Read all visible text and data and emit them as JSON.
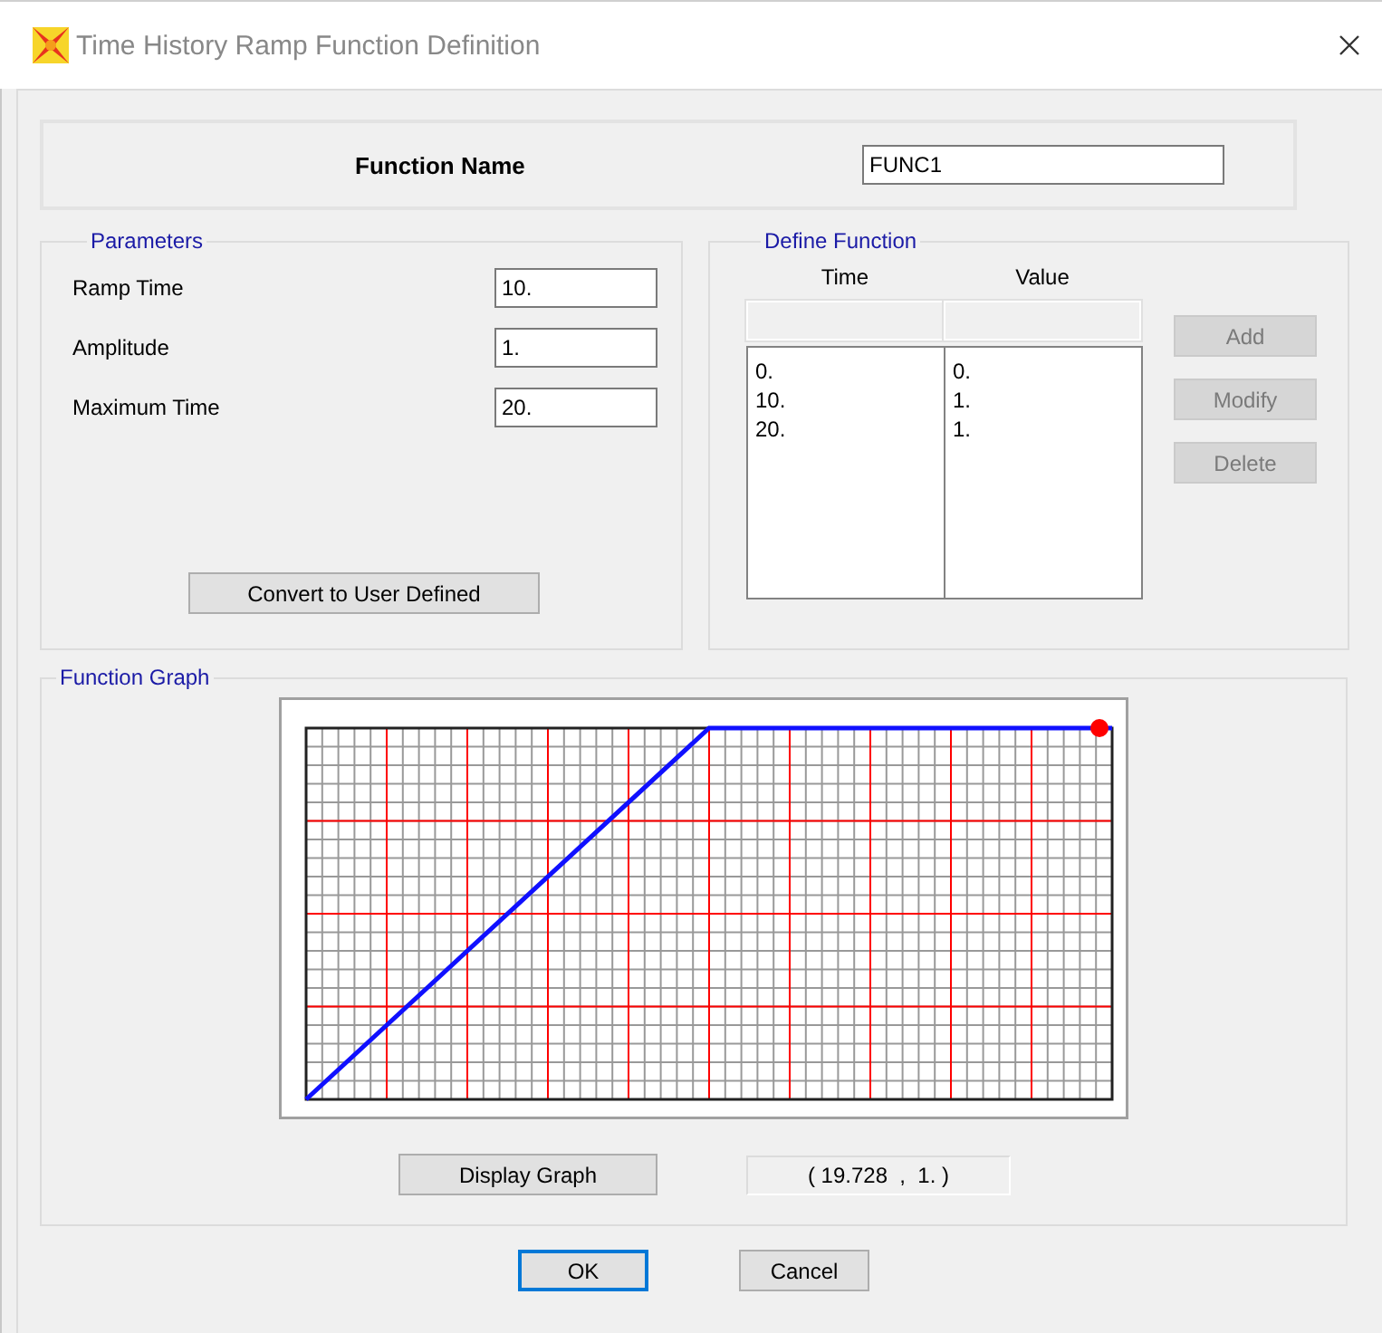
{
  "window": {
    "title": "Time History Ramp Function Definition"
  },
  "function_name": {
    "label": "Function Name",
    "value": "FUNC1"
  },
  "parameters": {
    "title": "Parameters",
    "fields": [
      {
        "label": "Ramp Time",
        "value": "10."
      },
      {
        "label": "Amplitude",
        "value": "1."
      },
      {
        "label": "Maximum Time",
        "value": "20."
      }
    ],
    "convert_button": "Convert to User Defined"
  },
  "define_function": {
    "title": "Define Function",
    "columns": [
      "Time",
      "Value"
    ],
    "rows": [
      [
        "0.",
        "0."
      ],
      [
        "10.",
        "1."
      ],
      [
        "20.",
        "1."
      ]
    ],
    "buttons": [
      {
        "label": "Add",
        "disabled": true
      },
      {
        "label": "Modify",
        "disabled": true
      },
      {
        "label": "Delete",
        "disabled": true
      }
    ]
  },
  "function_graph": {
    "title": "Function Graph",
    "display_button": "Display Graph",
    "readout": "( 19.728  ,  1. )"
  },
  "buttons": [
    {
      "label": "OK",
      "default": true
    },
    {
      "label": "Cancel",
      "default": false
    }
  ]
}
